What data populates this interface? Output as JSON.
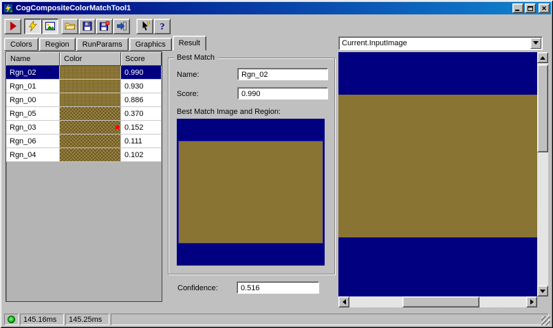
{
  "colors": {
    "navy": "#000080",
    "titlebar_start": "#000080",
    "titlebar_end": "#1084d0",
    "tan": "#8a7434",
    "window_gray": "#c0c0c0",
    "selection": "#000080"
  },
  "window": {
    "title": "CogCompositeColorMatchTool1"
  },
  "toolbar": {
    "buttons": [
      {
        "icon": "run-icon",
        "pressed": false
      },
      {
        "icon": "electric-run-icon",
        "pressed": true
      },
      {
        "icon": "image-display-icon",
        "pressed": true
      },
      {
        "icon": "open-file-icon",
        "pressed": false
      },
      {
        "icon": "save-icon",
        "pressed": false
      },
      {
        "icon": "save-image-icon",
        "pressed": false
      },
      {
        "icon": "import-icon",
        "pressed": false
      },
      {
        "icon": "position-probe-icon",
        "pressed": false
      },
      {
        "icon": "help-icon",
        "pressed": false
      }
    ]
  },
  "tabs": {
    "items": [
      "Colors",
      "Region",
      "RunParams",
      "Graphics",
      "Result"
    ],
    "active": "Result"
  },
  "results_table": {
    "columns": [
      "Name",
      "Color",
      "Score"
    ],
    "rows": [
      {
        "name": "Rgn_02",
        "score": "0.990",
        "selected": true
      },
      {
        "name": "Rgn_01",
        "score": "0.930",
        "selected": false
      },
      {
        "name": "Rgn_00",
        "score": "0.886",
        "selected": false
      },
      {
        "name": "Rgn_05",
        "score": "0.370",
        "selected": false
      },
      {
        "name": "Rgn_03",
        "score": "0.152",
        "selected": false
      },
      {
        "name": "Rgn_06",
        "score": "0.111",
        "selected": false
      },
      {
        "name": "Rgn_04",
        "score": "0.102",
        "selected": false
      }
    ]
  },
  "best_match": {
    "group_title": "Best Match",
    "name_label": "Name:",
    "name_value": "Rgn_02",
    "score_label": "Score:",
    "score_value": "0.990",
    "image_caption": "Best Match Image and Region:",
    "confidence_label": "Confidence:",
    "confidence_value": "0.516"
  },
  "viewer": {
    "image_selector_value": "Current.InputImage"
  },
  "statusbar": {
    "run_time": "145.16ms",
    "total_time": "145.25ms"
  }
}
